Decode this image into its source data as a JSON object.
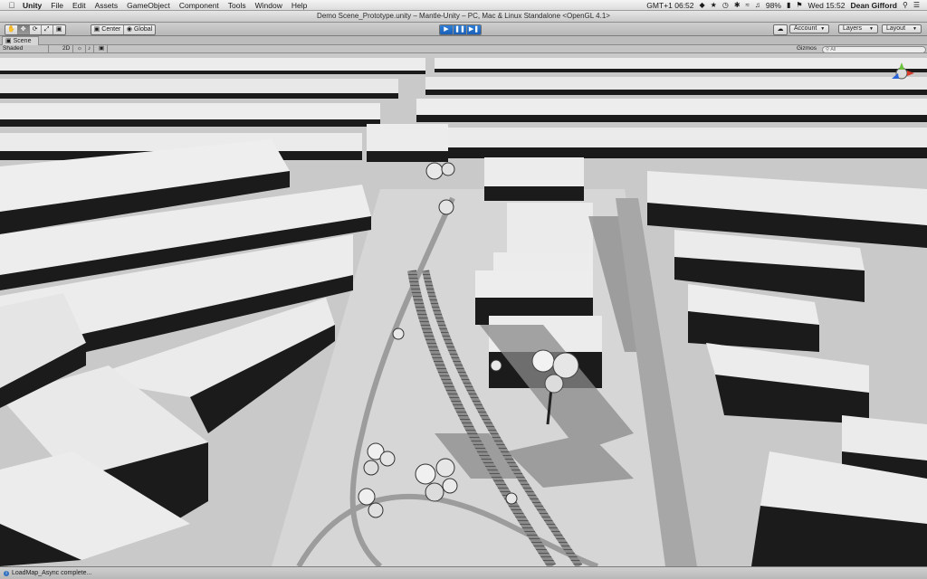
{
  "menubar": {
    "app_name": "Unity",
    "items": [
      "File",
      "Edit",
      "Assets",
      "GameObject",
      "Component",
      "Tools",
      "Window",
      "Help"
    ],
    "timezone": "GMT+1 06:52",
    "battery": "98%",
    "clock": "Wed 15:52",
    "user": "Dean Gifford"
  },
  "window": {
    "title": "Demo Scene_Prototype.unity – Mantle-Unity – PC, Mac & Linux Standalone <OpenGL 4.1>"
  },
  "toolbar": {
    "pivot_label": "Center",
    "space_label": "Global",
    "account_label": "Account",
    "layers_label": "Layers",
    "layout_label": "Layout"
  },
  "scene": {
    "tab_label": "Scene",
    "shading_mode": "Shaded",
    "mode_2d": "2D",
    "gizmos_label": "Gizmos",
    "search_placeholder": "All"
  },
  "status": {
    "message": "LoadMap_Async complete..."
  },
  "colors": {
    "ground": "#c8c8c8",
    "roof": "#ececec",
    "wall_dark": "#1b1b1b",
    "path": "#9a9a9a",
    "play_blue": "#2f7fd8"
  }
}
